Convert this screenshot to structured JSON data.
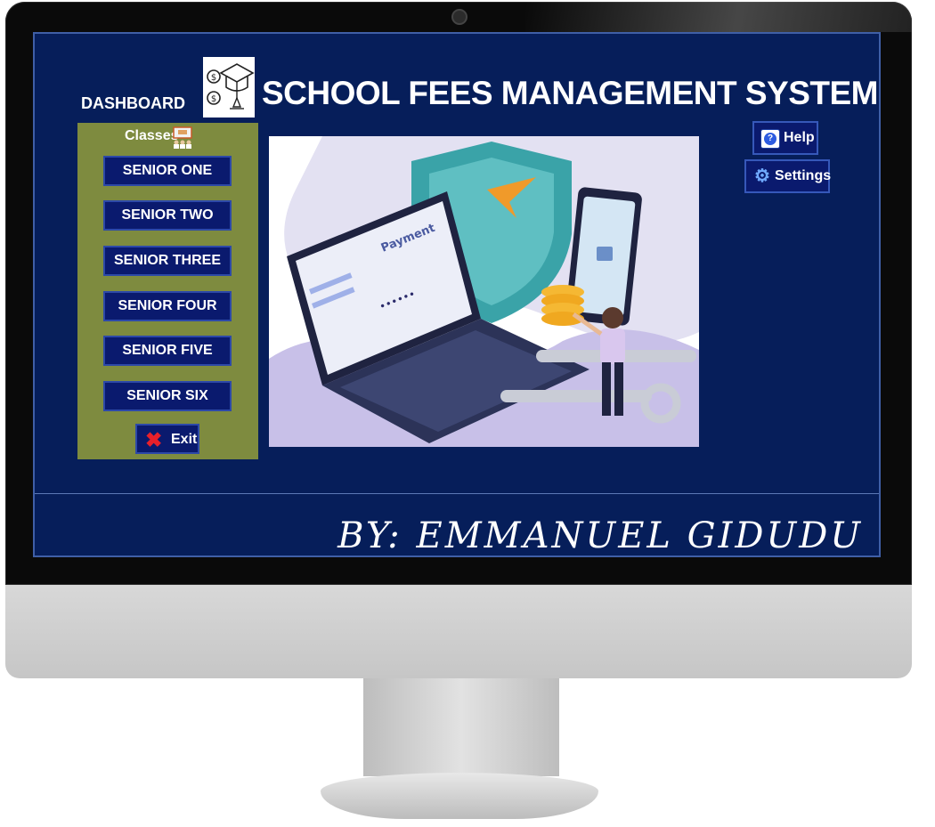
{
  "header": {
    "dashboard_label": "DASHBOARD",
    "app_title": "SCHOOL FEES MANAGEMENT SYSTEM"
  },
  "sidebar": {
    "section_label": "Classes",
    "classes": [
      {
        "label": "SENIOR ONE"
      },
      {
        "label": "SENIOR TWO"
      },
      {
        "label": "SENIOR THREE"
      },
      {
        "label": "SENIOR FOUR"
      },
      {
        "label": "SENIOR FIVE"
      },
      {
        "label": "SENIOR SIX"
      }
    ],
    "exit_label": "Exit"
  },
  "actions": {
    "help_label": "Help",
    "settings_label": "Settings"
  },
  "hero": {
    "payment_text": "Payment",
    "password_dots": "••••••"
  },
  "footer": {
    "author": "BY: EMMANUEL GIDUDU"
  },
  "colors": {
    "screen_bg": "#061e5a",
    "panel_bg": "#7e8b3f",
    "button_bg": "#0a1a6e",
    "exit_icon": "#e8202a"
  },
  "icons": {
    "logo": "money-graduation-cap-icon",
    "classes": "classroom-icon",
    "exit": "close-icon",
    "help": "question-icon",
    "settings": "gear-icon"
  }
}
